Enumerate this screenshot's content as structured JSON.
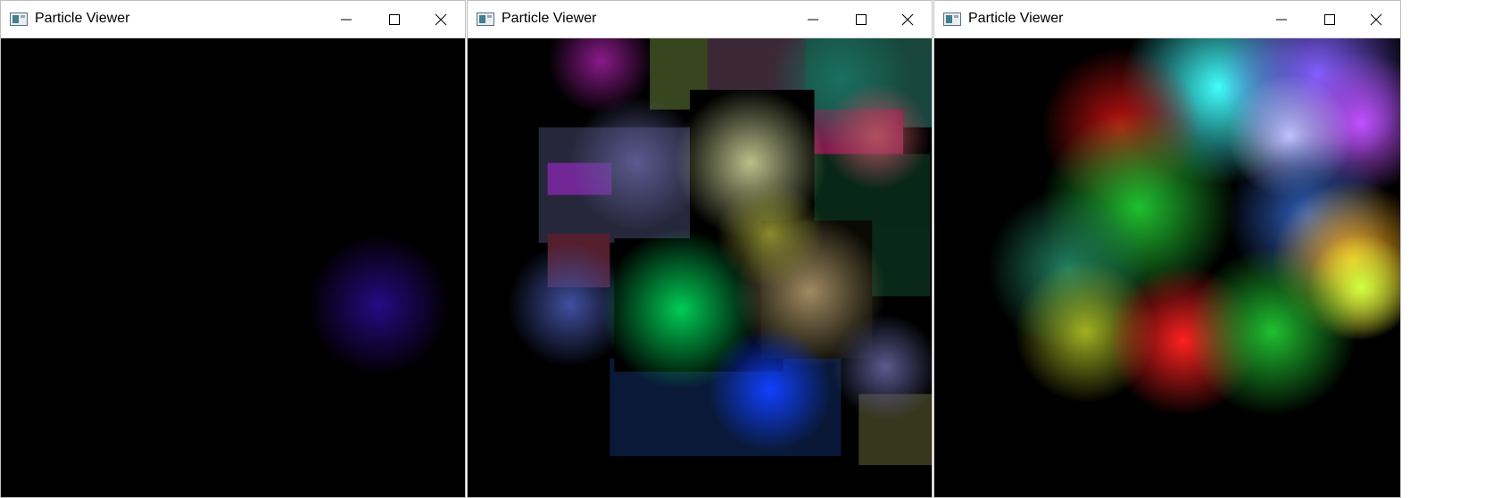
{
  "windows": [
    {
      "title": "Particle Viewer",
      "controls": {
        "minimize_icon": "minimize-icon",
        "maximize_icon": "maximize-icon",
        "close_icon": "close-icon"
      }
    },
    {
      "title": "Particle Viewer",
      "controls": {
        "minimize_icon": "minimize-icon",
        "maximize_icon": "maximize-icon",
        "close_icon": "close-icon"
      }
    },
    {
      "title": "Particle Viewer",
      "controls": {
        "minimize_icon": "minimize-icon",
        "maximize_icon": "maximize-icon",
        "close_icon": "close-icon"
      }
    }
  ],
  "colors": {
    "titlebar_bg": "#ffffff",
    "canvas_bg": "#000000",
    "glyph": "#000000"
  }
}
